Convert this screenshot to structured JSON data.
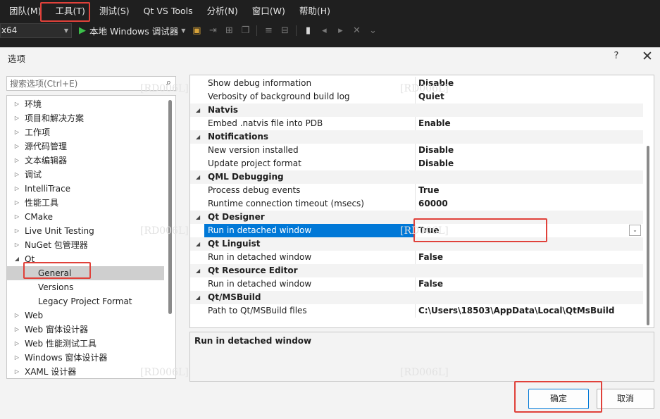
{
  "menubar": {
    "items": [
      "团队(M)",
      "工具(T)",
      "测试(S)",
      "Qt VS Tools",
      "分析(N)",
      "窗口(W)",
      "帮助(H)"
    ]
  },
  "toolbar": {
    "platform": "x64",
    "run_label": "本地 Windows 调试器"
  },
  "dialog": {
    "title": "选项",
    "help": "?",
    "close": "✕",
    "search_placeholder": "搜索选项(Ctrl+E)",
    "tree": [
      {
        "label": "环境",
        "level": 0,
        "expanded": false,
        "selected": false
      },
      {
        "label": "项目和解决方案",
        "level": 0,
        "expanded": false,
        "selected": false
      },
      {
        "label": "工作项",
        "level": 0,
        "expanded": false,
        "selected": false
      },
      {
        "label": "源代码管理",
        "level": 0,
        "expanded": false,
        "selected": false
      },
      {
        "label": "文本编辑器",
        "level": 0,
        "expanded": false,
        "selected": false
      },
      {
        "label": "调试",
        "level": 0,
        "expanded": false,
        "selected": false
      },
      {
        "label": "IntelliTrace",
        "level": 0,
        "expanded": false,
        "selected": false
      },
      {
        "label": "性能工具",
        "level": 0,
        "expanded": false,
        "selected": false
      },
      {
        "label": "CMake",
        "level": 0,
        "expanded": false,
        "selected": false
      },
      {
        "label": "Live Unit Testing",
        "level": 0,
        "expanded": false,
        "selected": false
      },
      {
        "label": "NuGet 包管理器",
        "level": 0,
        "expanded": false,
        "selected": false
      },
      {
        "label": "Qt",
        "level": 0,
        "expanded": true,
        "selected": false
      },
      {
        "label": "General",
        "level": 1,
        "expanded": false,
        "selected": true
      },
      {
        "label": "Versions",
        "level": 1,
        "expanded": false,
        "selected": false
      },
      {
        "label": "Legacy Project Format",
        "level": 1,
        "expanded": false,
        "selected": false
      },
      {
        "label": "Web",
        "level": 0,
        "expanded": false,
        "selected": false
      },
      {
        "label": "Web 窗体设计器",
        "level": 0,
        "expanded": false,
        "selected": false
      },
      {
        "label": "Web 性能测试工具",
        "level": 0,
        "expanded": false,
        "selected": false
      },
      {
        "label": "Windows 窗体设计器",
        "level": 0,
        "expanded": false,
        "selected": false
      },
      {
        "label": "XAML 设计器",
        "level": 0,
        "expanded": false,
        "selected": false
      }
    ],
    "properties": [
      {
        "kind": "prop",
        "name": "Show debug information",
        "value": "Disable"
      },
      {
        "kind": "prop",
        "name": "Verbosity of background build log",
        "value": "Quiet"
      },
      {
        "kind": "cat",
        "name": "Natvis"
      },
      {
        "kind": "prop",
        "name": "Embed .natvis file into PDB",
        "value": "Enable"
      },
      {
        "kind": "cat",
        "name": "Notifications"
      },
      {
        "kind": "prop",
        "name": "New version installed",
        "value": "Disable"
      },
      {
        "kind": "prop",
        "name": "Update project format",
        "value": "Disable"
      },
      {
        "kind": "cat",
        "name": "QML Debugging"
      },
      {
        "kind": "prop",
        "name": "Process debug events",
        "value": "True"
      },
      {
        "kind": "prop",
        "name": "Runtime connection timeout (msecs)",
        "value": "60000"
      },
      {
        "kind": "cat",
        "name": "Qt Designer"
      },
      {
        "kind": "prop",
        "name": "Run in detached window",
        "value": "True",
        "selected": true
      },
      {
        "kind": "cat",
        "name": "Qt Linguist"
      },
      {
        "kind": "prop",
        "name": "Run in detached window",
        "value": "False"
      },
      {
        "kind": "cat",
        "name": "Qt Resource Editor"
      },
      {
        "kind": "prop",
        "name": "Run in detached window",
        "value": "False"
      },
      {
        "kind": "cat",
        "name": "Qt/MSBuild"
      },
      {
        "kind": "prop",
        "name": "Path to Qt/MSBuild files",
        "value": "C:\\Users\\18503\\AppData\\Local\\QtMsBuild"
      }
    ],
    "description_title": "Run in detached window",
    "ok_label": "确定",
    "cancel_label": "取消"
  },
  "watermark_text": "[RD006L]",
  "colors": {
    "selection_blue": "#0078d7",
    "highlight_red": "#e0413a",
    "run_green": "#3cbf4a"
  }
}
